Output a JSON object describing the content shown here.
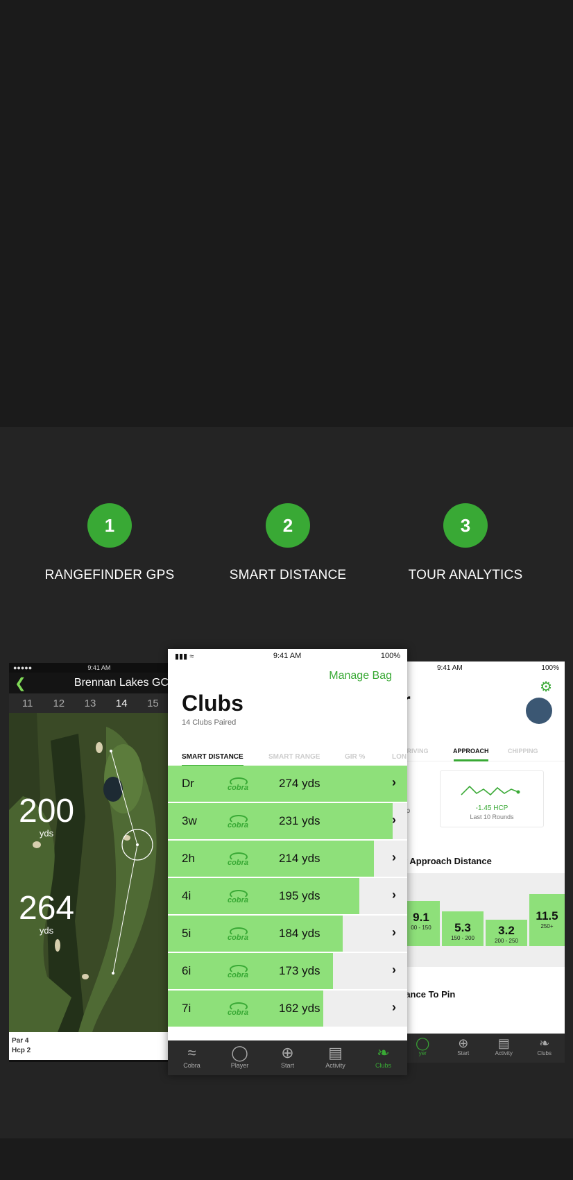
{
  "steps": [
    {
      "number": "1",
      "label": "RANGEFINDER GPS"
    },
    {
      "number": "2",
      "label": "SMART DISTANCE"
    },
    {
      "number": "3",
      "label": "TOUR ANALYTICS"
    }
  ],
  "gps_screen": {
    "status_time": "9:41 AM",
    "course_title": "Brennan Lakes GC",
    "holes": [
      "11",
      "12",
      "13",
      "14",
      "15"
    ],
    "current_hole": "14",
    "distances": [
      {
        "value": "200",
        "unit": "yds"
      },
      {
        "value": "264",
        "unit": "yds"
      }
    ],
    "par": "Par 4",
    "hcp": "Hcp 2"
  },
  "clubs_screen": {
    "status_time": "9:41 AM",
    "battery": "100%",
    "manage_bag": "Manage Bag",
    "title": "Clubs",
    "subtitle": "14 Clubs Paired",
    "tabs": [
      "SMART DISTANCE",
      "SMART RANGE",
      "GIR %",
      "LON"
    ],
    "clubs": [
      {
        "name": "Dr",
        "logo": "cobra",
        "distance": "274 yds",
        "fill": 1.0
      },
      {
        "name": "3w",
        "logo": "cobra",
        "distance": "231 yds",
        "fill": 0.94
      },
      {
        "name": "2h",
        "logo": "cobra",
        "distance": "214 yds",
        "fill": 0.86
      },
      {
        "name": "4i",
        "logo": "cobra",
        "distance": "195 yds",
        "fill": 0.8
      },
      {
        "name": "5i",
        "logo": "cobra",
        "distance": "184 yds",
        "fill": 0.73
      },
      {
        "name": "6i",
        "logo": "cobra",
        "distance": "173 yds",
        "fill": 0.69
      },
      {
        "name": "7i",
        "logo": "cobra",
        "distance": "162 yds",
        "fill": 0.65
      }
    ],
    "tabbar": [
      {
        "label": "Cobra",
        "icon": "cobra-icon"
      },
      {
        "label": "Player",
        "icon": "player-icon"
      },
      {
        "label": "Start",
        "icon": "plus-circle-icon"
      },
      {
        "label": "Activity",
        "icon": "activity-icon"
      },
      {
        "label": "Clubs",
        "icon": "clubs-icon"
      }
    ]
  },
  "analytics_screen": {
    "status_time": "9:41 AM",
    "battery": "100%",
    "title_partial": "r",
    "tabs": [
      "DRIVING",
      "APPROACH",
      "CHIPPING"
    ],
    "hcp_value": "-1.45 HCP",
    "hcp_caption": "Last 10 Rounds",
    "side_text": "ap",
    "section_approach": "y Approach Distance",
    "section_pin": "tance To Pin",
    "buckets": [
      {
        "value": "9.1",
        "range": "00 - 150"
      },
      {
        "value": "5.3",
        "range": "150 - 200"
      },
      {
        "value": "3.2",
        "range": "200 - 250"
      },
      {
        "value": "11.5",
        "range": "250+"
      }
    ],
    "tabbar": [
      "yer",
      "Start",
      "Activity",
      "Clubs"
    ]
  },
  "colors": {
    "accent": "#39a935",
    "bar_green": "#8ee07a"
  }
}
